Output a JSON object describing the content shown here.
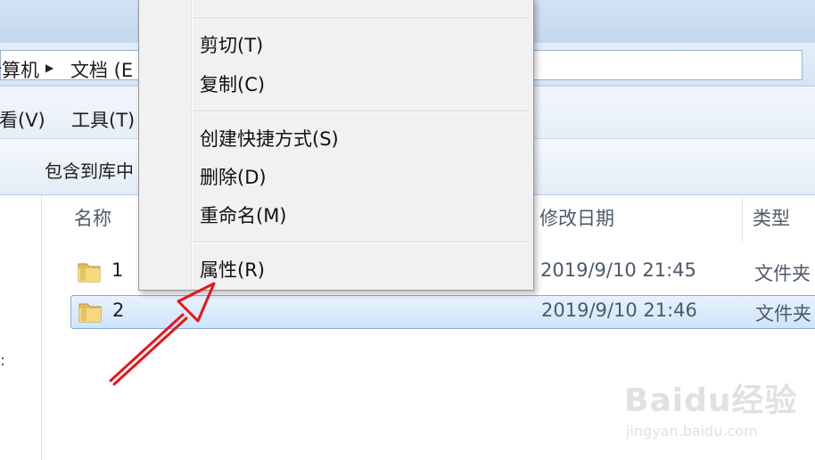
{
  "window": {
    "breadcrumb": [
      "计算机",
      "文档 (E"
    ],
    "menu": [
      "查看(V)",
      "工具(T)"
    ],
    "toolbar": {
      "include_library": "包含到库中"
    }
  },
  "file_list": {
    "columns": {
      "name": "名称",
      "modified": "修改日期",
      "type": "类型"
    },
    "rows": [
      {
        "name": "1",
        "modified": "2019/9/10 21:45",
        "type": "文件夹",
        "selected": false
      },
      {
        "name": "2",
        "modified": "2019/9/10 21:46",
        "type": "文件夹",
        "selected": true
      }
    ]
  },
  "context_menu": {
    "items": [
      "剪切(T)",
      "复制(C)",
      "创建快捷方式(S)",
      "删除(D)",
      "重命名(M)",
      "属性(R)"
    ]
  },
  "annotation": {
    "arrow_color": "#e8141b",
    "target": "属性(R)"
  },
  "watermark": {
    "logo": "Baidu经验",
    "site": "jingyan.baidu.com"
  },
  "colors": {
    "selection_border": "#84acdd",
    "folder_yellow": "#e9c35a"
  }
}
